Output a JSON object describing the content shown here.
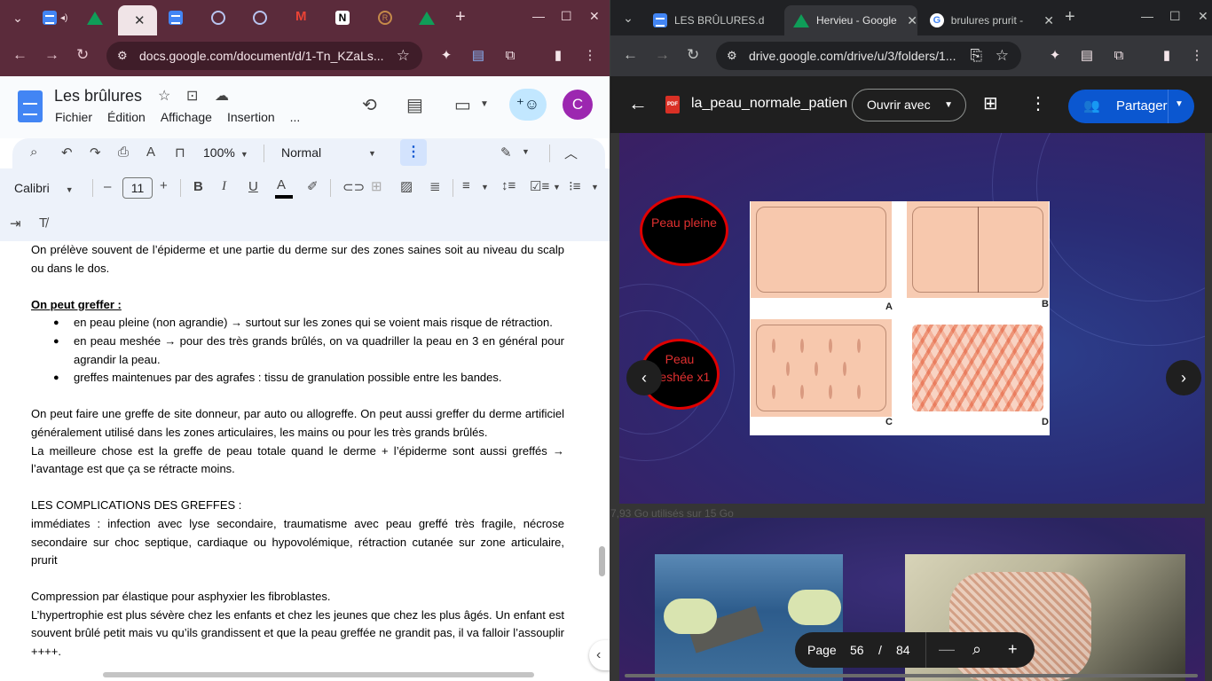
{
  "left_window": {
    "tabs": [
      {
        "icon": "google-docs-icon"
      },
      {
        "icon": "google-drive-icon"
      },
      {
        "icon": "blank-tab",
        "active": true
      },
      {
        "icon": "google-docs-icon"
      },
      {
        "icon": "circle-icon"
      },
      {
        "icon": "circle-icon"
      },
      {
        "icon": "gmail-icon"
      },
      {
        "icon": "notion-icon"
      },
      {
        "icon": "r-circle-icon"
      },
      {
        "icon": "google-drive-icon"
      }
    ],
    "url": "docs.google.com/document/d/1-Tn_KZaLs...",
    "doc_title": "Les brûlures",
    "menu": [
      "Fichier",
      "Édition",
      "Affichage",
      "Insertion",
      "..."
    ],
    "avatar_letter": "C",
    "toolbar": {
      "zoom": "100%",
      "style": "Normal",
      "font": "Calibri",
      "font_size": "11",
      "minus": "–",
      "plus": "+"
    },
    "document": {
      "p1": "On prélève souvent de l’épiderme et une partie du derme sur des zones saines soit au niveau du scalp ou dans le dos.",
      "heading1": "On peut greffer :",
      "bullets": [
        "en peau pleine (non agrandie) → surtout sur les zones qui se voient mais risque de rétraction.",
        "en peau meshée → pour des très grands brûlés, on va quadriller la peau en 3 en général pour agrandir la peau.",
        "greffes maintenues par des agrafes : tissu de granulation possible entre les bandes."
      ],
      "p2": "On peut faire une greffe de site donneur, par auto ou allogreffe. On peut aussi greffer du derme artificiel généralement utilisé dans les zones articulaires, les mains ou pour les très grands brûlés.",
      "p3": "La meilleure chose est la greffe de peau totale quand le derme + l’épiderme sont aussi greffés → l’avantage est que ça se rétracte moins.",
      "p4": "LES COMPLICATIONS DES GREFFES :",
      "p5": "immédiates : infection avec lyse secondaire, traumatisme avec peau greffé très fragile, nécrose secondaire sur choc septique, cardiaque ou hypovolémique, rétraction cutanée sur zone articulaire, prurit",
      "p6": "Compression par élastique pour asphyxier les fibroblastes.",
      "p7": "L’hypertrophie est plus sévère chez les enfants et chez les jeunes que chez les plus âgés. Un enfant est souvent brûlé petit mais vu qu’ils grandissent et que la peau greffée ne grandit pas, il va falloir l’assouplir ++++."
    }
  },
  "right_window": {
    "tabs": [
      {
        "label": "LES BRÛLURES.d",
        "icon": "google-docs-icon"
      },
      {
        "label": "Hervieu - Google",
        "icon": "google-drive-icon",
        "active": true
      },
      {
        "label": "brulures prurit -",
        "icon": "google-icon"
      }
    ],
    "url": "drive.google.com/drive/u/3/folders/1...",
    "viewer": {
      "file_name": "la_peau_normale_patien",
      "open_with": "Ouvrir avec",
      "share": "Partager",
      "slide": {
        "oval1": "Peau pleine",
        "oval2": "Peau meshée x1",
        "figure_labels": [
          "A",
          "B",
          "C",
          "D"
        ]
      },
      "storage_text": "7,93 Go utilisés sur 15 Go",
      "pager": {
        "label": "Page",
        "current": "56",
        "separator": "/",
        "total": "84"
      }
    }
  }
}
